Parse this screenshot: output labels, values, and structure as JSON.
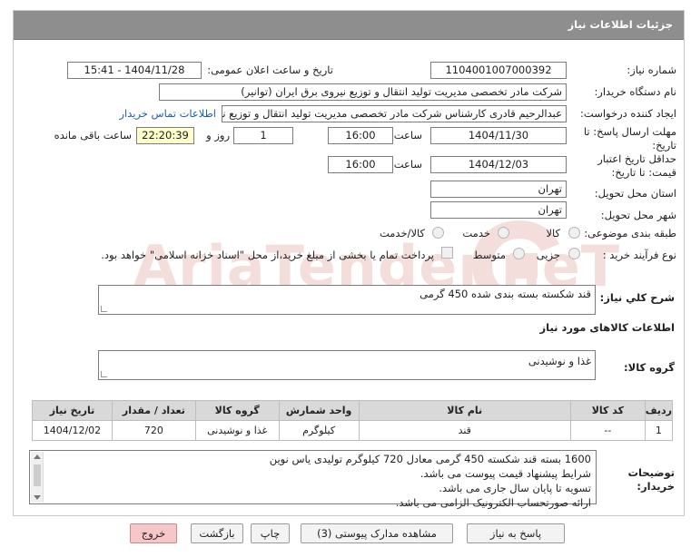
{
  "header": {
    "title": "جزئیات اطلاعات نیاز"
  },
  "form": {
    "need_number_label": "شماره نیاز:",
    "need_number": "1104001007000392",
    "announce_label": "تاریخ و ساعت اعلان عمومی:",
    "announce_value": "1404/11/28 - 15:41",
    "buyer_org_label": "نام دستگاه خریدار:",
    "buyer_org": "شرکت مادر تخصصی مدیریت تولید  انتقال و توزیع نیروی برق ایران (توانیر)",
    "creator_label": "ایجاد کننده درخواست:",
    "creator": "عبدالرحیم قادری کارشناس شرکت مادر تخصصی مدیریت تولید  انتقال و توزیع نیر",
    "contact_link": "اطلاعات تماس خریدار",
    "deadline_label": "مهلت ارسال پاسخ: تا تاریخ:",
    "deadline_date": "1404/11/30",
    "time_label": "ساعت",
    "deadline_time": "16:00",
    "days_value": "1",
    "days_label": "روز و",
    "remaining_time": "22:20:39",
    "remaining_label": "ساعت باقی مانده",
    "validity_label": "حداقل تاریخ اعتبار قیمت: تا تاریخ:",
    "validity_date": "1404/12/03",
    "validity_time_label": "ساعت",
    "validity_time": "16:00",
    "province_label": "استان محل تحویل:",
    "province": "تهران",
    "city_label": "شهر محل تحویل:",
    "city": "تهران",
    "category_label": "طبقه بندی موضوعی:",
    "category_options": [
      "کالا",
      "خدمت",
      "کالا/خدمت"
    ],
    "process_label": "نوع فرآیند خرید :",
    "process_options": [
      "جزیی",
      "متوسط"
    ],
    "payment_note": "پرداخت تمام یا بخشی از مبلغ خرید،از محل \"اسناد خزانه اسلامی\" خواهد بود."
  },
  "summary": {
    "label": "شرح کلي نياز:",
    "value": "قند شکسته بسته بندی شده 450 گرمی"
  },
  "goods_section": {
    "title": "اطلاعات کالاهای مورد نیاز"
  },
  "goods_group": {
    "label": "گروه کالا:",
    "value": "غذا و نوشیدنی"
  },
  "table": {
    "headers": [
      "ردیف",
      "کد کالا",
      "نام کالا",
      "واحد شمارش",
      "گروه کالا",
      "تعداد / مقدار",
      "تاریخ نیاز"
    ],
    "rows": [
      [
        "1",
        "--",
        "قند",
        "کیلوگرم",
        "غذا و نوشیدنی",
        "720",
        "1404/12/02"
      ]
    ]
  },
  "notes": {
    "label": "توضیحات خریدار:",
    "lines": [
      "1600 بسته قند شکسته 450 گرمی معادل 720 کیلوگرم تولیدی یاس نوین",
      "شرایط پیشنهاد قیمت پیوست می باشد.",
      "تسویه تا پایان سال جاری می باشد.",
      "ارائه صورتحساب الکترونیک الزامی می باشد."
    ]
  },
  "buttons": {
    "reply": "پاسخ به نیاز",
    "attachments": "مشاهده مدارک پیوستی (3)",
    "print": "چاپ",
    "back": "بازگشت",
    "exit": "خروج"
  },
  "watermark": {
    "text": "AriaTender.neT"
  },
  "colors": {
    "header_bg": "#8e8e8e",
    "link": "#1a5fb4",
    "highlight": "#ffffcc",
    "exit_btn": "#f7c6c6"
  }
}
